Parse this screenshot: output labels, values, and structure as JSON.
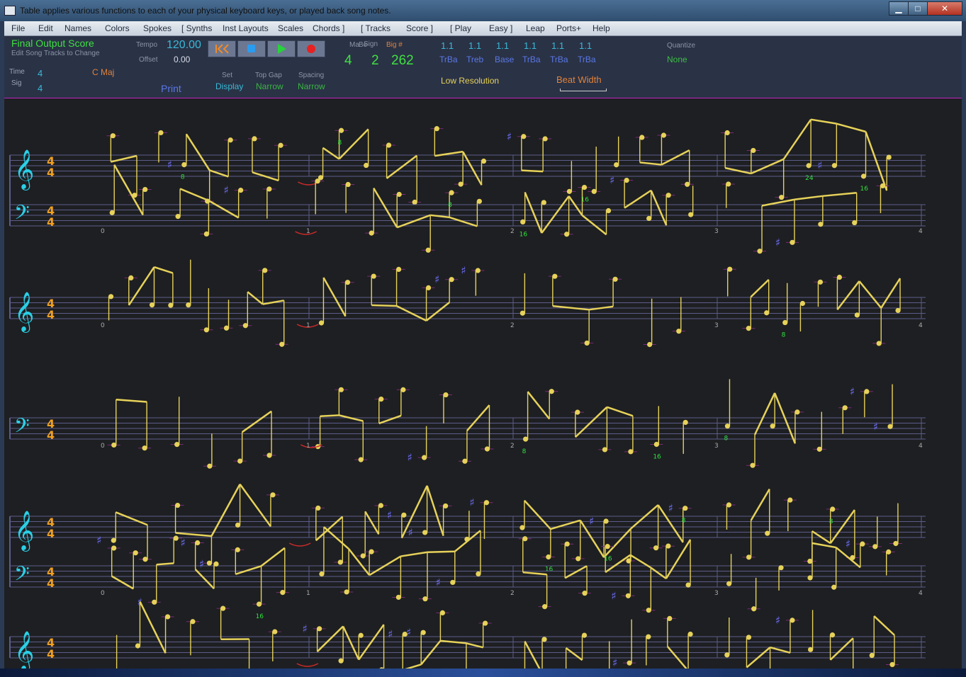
{
  "window": {
    "title": "Table applies various functions to each of your physical keyboard keys, or played back song notes.",
    "controls": {
      "minimize": "▁",
      "maximize": "□",
      "close": "✕"
    }
  },
  "menu": [
    "File",
    "Edit",
    "Names",
    "Colors",
    "Spokes",
    "[ Synths",
    "Inst Layouts",
    "Scales",
    "Chords ]",
    "[ Tracks",
    "Score ]",
    "[ Play",
    "Easy ]",
    "Leap",
    "Ports+",
    "Help"
  ],
  "toolbar": {
    "score_title": "Final Output Score",
    "score_subtitle": "Edit Song Tracks to Change",
    "time_label": "Time",
    "time_value": "4",
    "sig_label": "Sig",
    "sig_value": "4",
    "key": "C Maj",
    "tempo_label": "Tempo",
    "tempo_value": "120.00",
    "offset_label": "Offset",
    "offset_value": "0.00",
    "print": "Print",
    "set_label": "Set",
    "set_value": "Display",
    "topgap_label": "Top Gap",
    "topgap_value": "Narrow",
    "spacing_label": "Spacing",
    "spacing_value": "Narrow",
    "measure_label": "Ma",
    "beat_label": "Be",
    "sign_label": "Sign",
    "big_label": "Big #",
    "measure_value": "4",
    "beat_value": "2",
    "big_value": "262",
    "tracks": [
      {
        "num": "1.1",
        "name": "TrBa"
      },
      {
        "num": "1.1",
        "name": "Treb"
      },
      {
        "num": "1.1",
        "name": "Base"
      },
      {
        "num": "1.1",
        "name": "TrBa"
      },
      {
        "num": "1.1",
        "name": "TrBa"
      },
      {
        "num": "1.1",
        "name": "TrBa"
      }
    ],
    "low_resolution": "Low Resolution",
    "beat_width": "Beat Width",
    "quantize_label": "Quantize",
    "quantize_value": "None"
  },
  "score": {
    "measure_numbers": [
      "0",
      "1",
      "2",
      "3",
      "4"
    ],
    "fingering": [
      "8",
      "16",
      "24"
    ],
    "clefs": {
      "treble": "𝄞",
      "bass": "𝄢"
    },
    "time_signature": {
      "top": "4",
      "bottom": "4"
    },
    "accidental": "♯",
    "rest": "𝄽",
    "colors": {
      "note": "#e6d25a",
      "staff_line": "#5c5c8a",
      "clef": "#2ad0e6",
      "time_sig": "#f0a020",
      "sharp": "#7070ff",
      "finger": "#30e040",
      "tie": "#cc2a2a",
      "ledger": "#7a2a7a"
    }
  }
}
